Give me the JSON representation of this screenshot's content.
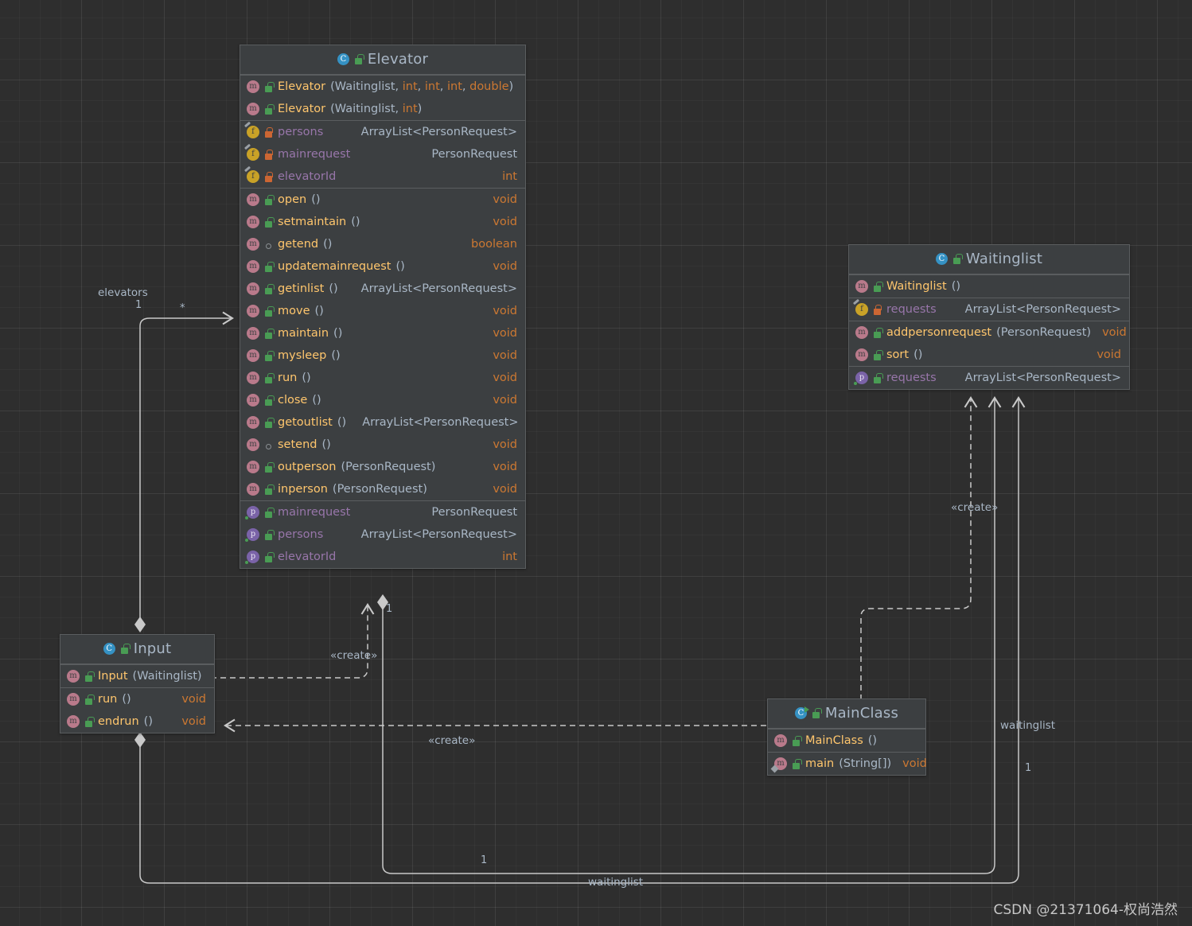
{
  "diagram": {
    "type": "uml-class-diagram",
    "watermark": "CSDN @21371064-权尚浩然",
    "colors": {
      "background": "#2e2e2e",
      "class_box": "#3c3f41",
      "border": "#5a5d5f",
      "title_text": "#a9b7c6",
      "method_name": "#ffc66d",
      "field_name": "#9876aa",
      "primitive_type": "#cc7832",
      "object_type": "#a9b7c6",
      "edge": "#c9c9c9",
      "class_icon": "#3592c4",
      "method_icon": "#b97a8b",
      "field_icon": "#c9a227",
      "property_icon": "#7a63a8",
      "lock_public": "#499c54",
      "lock_private": "#cc6633"
    }
  },
  "classes": {
    "elevator": {
      "name": "Elevator",
      "icon": "class-icon",
      "visibility_icon": "unlocked-public-icon",
      "sections": [
        {
          "kind": "constructors",
          "rows": [
            {
              "icon": "method-icon",
              "lock": "public",
              "name": "Elevator",
              "params": [
                {
                  "text": "Waitinglist",
                  "kind": "object"
                },
                {
                  "text": "int",
                  "kind": "primitive"
                },
                {
                  "text": "int",
                  "kind": "primitive"
                },
                {
                  "text": "int",
                  "kind": "primitive"
                },
                {
                  "text": "double",
                  "kind": "primitive"
                }
              ],
              "return": ""
            },
            {
              "icon": "method-icon",
              "lock": "public",
              "name": "Elevator",
              "params": [
                {
                  "text": "Waitinglist",
                  "kind": "object"
                },
                {
                  "text": "int",
                  "kind": "primitive"
                }
              ],
              "return": ""
            }
          ]
        },
        {
          "kind": "fields",
          "rows": [
            {
              "icon": "field-icon",
              "lock": "private",
              "name": "persons",
              "return": "ArrayList<PersonRequest>",
              "return_kind": "object"
            },
            {
              "icon": "field-icon",
              "lock": "private",
              "name": "mainrequest",
              "return": "PersonRequest",
              "return_kind": "object"
            },
            {
              "icon": "field-icon",
              "lock": "private",
              "name": "elevatorId",
              "return": "int",
              "return_kind": "primitive"
            }
          ]
        },
        {
          "kind": "methods",
          "rows": [
            {
              "icon": "method-icon",
              "lock": "public",
              "name": "open",
              "params": [],
              "return": "void",
              "return_kind": "primitive"
            },
            {
              "icon": "method-icon",
              "lock": "public",
              "name": "setmaintain ",
              "params": [],
              "return": "void",
              "return_kind": "primitive"
            },
            {
              "icon": "method-icon",
              "lock": "package",
              "name": "getend",
              "params": [],
              "return": "boolean",
              "return_kind": "primitive"
            },
            {
              "icon": "method-icon",
              "lock": "public",
              "name": "updatemainrequest",
              "params": [],
              "return": "void",
              "return_kind": "primitive"
            },
            {
              "icon": "method-icon",
              "lock": "public",
              "name": "getinlist",
              "params": [],
              "return": "ArrayList<PersonRequest>",
              "return_kind": "object"
            },
            {
              "icon": "method-icon",
              "lock": "public",
              "name": "move",
              "params": [],
              "return": "void",
              "return_kind": "primitive"
            },
            {
              "icon": "method-icon",
              "lock": "public",
              "name": "maintain ",
              "params": [],
              "return": "void",
              "return_kind": "primitive"
            },
            {
              "icon": "method-icon",
              "lock": "public",
              "name": "mysleep",
              "params": [],
              "return": "void",
              "return_kind": "primitive"
            },
            {
              "icon": "method-icon",
              "lock": "public",
              "name": "run",
              "params": [],
              "return": "void",
              "return_kind": "primitive"
            },
            {
              "icon": "method-icon",
              "lock": "public",
              "name": "close",
              "params": [],
              "return": "void",
              "return_kind": "primitive"
            },
            {
              "icon": "method-icon",
              "lock": "public",
              "name": "getoutlist",
              "params": [],
              "return": "ArrayList<PersonRequest>",
              "return_kind": "object"
            },
            {
              "icon": "method-icon",
              "lock": "package",
              "name": "setend",
              "params": [],
              "return": "void",
              "return_kind": "primitive"
            },
            {
              "icon": "method-icon",
              "lock": "public",
              "name": "outperson",
              "params": [
                {
                  "text": "PersonRequest",
                  "kind": "object"
                }
              ],
              "return": "void",
              "return_kind": "primitive"
            },
            {
              "icon": "method-icon",
              "lock": "public",
              "name": "inperson",
              "params": [
                {
                  "text": "PersonRequest",
                  "kind": "object"
                }
              ],
              "return": "void",
              "return_kind": "primitive"
            }
          ]
        },
        {
          "kind": "properties",
          "rows": [
            {
              "icon": "property-icon",
              "lock": "public",
              "name": "mainrequest",
              "return": "PersonRequest",
              "return_kind": "object"
            },
            {
              "icon": "property-icon",
              "lock": "public",
              "name": "persons",
              "return": "ArrayList<PersonRequest>",
              "return_kind": "object"
            },
            {
              "icon": "property-icon",
              "lock": "public",
              "name": "elevatorId",
              "return": "int",
              "return_kind": "primitive"
            }
          ]
        }
      ]
    },
    "waitinglist": {
      "name": "Waitinglist",
      "icon": "class-icon",
      "visibility_icon": "unlocked-public-icon",
      "sections": [
        {
          "kind": "constructors",
          "rows": [
            {
              "icon": "method-icon",
              "lock": "public",
              "name": "Waitinglist ",
              "params": [],
              "return": ""
            }
          ]
        },
        {
          "kind": "fields",
          "rows": [
            {
              "icon": "field-icon",
              "lock": "private",
              "name": "requests",
              "return": "ArrayList<PersonRequest>",
              "return_kind": "object"
            }
          ]
        },
        {
          "kind": "methods",
          "rows": [
            {
              "icon": "method-icon",
              "lock": "public",
              "name": "addpersonrequest",
              "params": [
                {
                  "text": "PersonRequest",
                  "kind": "object"
                }
              ],
              "return": "void",
              "return_kind": "primitive",
              "inline_return": true
            },
            {
              "icon": "method-icon",
              "lock": "public",
              "name": "sort",
              "params": [],
              "return": "void",
              "return_kind": "primitive"
            }
          ]
        },
        {
          "kind": "properties",
          "rows": [
            {
              "icon": "property-icon",
              "lock": "public",
              "name": "requests",
              "return": "ArrayList<PersonRequest>",
              "return_kind": "object"
            }
          ]
        }
      ]
    },
    "input": {
      "name": "Input",
      "icon": "class-icon",
      "visibility_icon": "unlocked-public-icon",
      "sections": [
        {
          "kind": "constructors",
          "rows": [
            {
              "icon": "method-icon",
              "lock": "public",
              "name": "Input",
              "params": [
                {
                  "text": "Waitinglist",
                  "kind": "object"
                }
              ],
              "return": ""
            }
          ]
        },
        {
          "kind": "methods",
          "rows": [
            {
              "icon": "method-icon",
              "lock": "public",
              "name": "run",
              "params": [],
              "return": "void",
              "return_kind": "primitive"
            },
            {
              "icon": "method-icon",
              "lock": "public",
              "name": "endrun",
              "params": [],
              "return": "void",
              "return_kind": "primitive"
            }
          ]
        }
      ]
    },
    "mainclass": {
      "name": "MainClass",
      "icon": "runnable-class-icon",
      "visibility_icon": "unlocked-public-icon",
      "sections": [
        {
          "kind": "constructors",
          "rows": [
            {
              "icon": "method-icon",
              "lock": "public",
              "name": "MainClass ",
              "params": [],
              "return": ""
            }
          ]
        },
        {
          "kind": "methods",
          "rows": [
            {
              "icon": "runnable-method-icon",
              "lock": "public",
              "name": "main ",
              "params": [
                {
                  "text": "String[]",
                  "kind": "object"
                }
              ],
              "return": "void",
              "return_kind": "primitive",
              "inline_return": true
            }
          ]
        }
      ]
    }
  },
  "edges": {
    "labels": {
      "elevators": "elevators",
      "create_1": "«create»",
      "create_2": "«create»",
      "create_3": "«create»",
      "waitinglist_right": "waitinglist",
      "waitinglist_bottom": "waitinglist"
    },
    "multiplicities": {
      "elevators_one": "1",
      "elevators_many": "*",
      "elevator_bottom_one": "1",
      "waitinglist_right_one": "1",
      "waitinglist_bottom_one": "1"
    }
  }
}
